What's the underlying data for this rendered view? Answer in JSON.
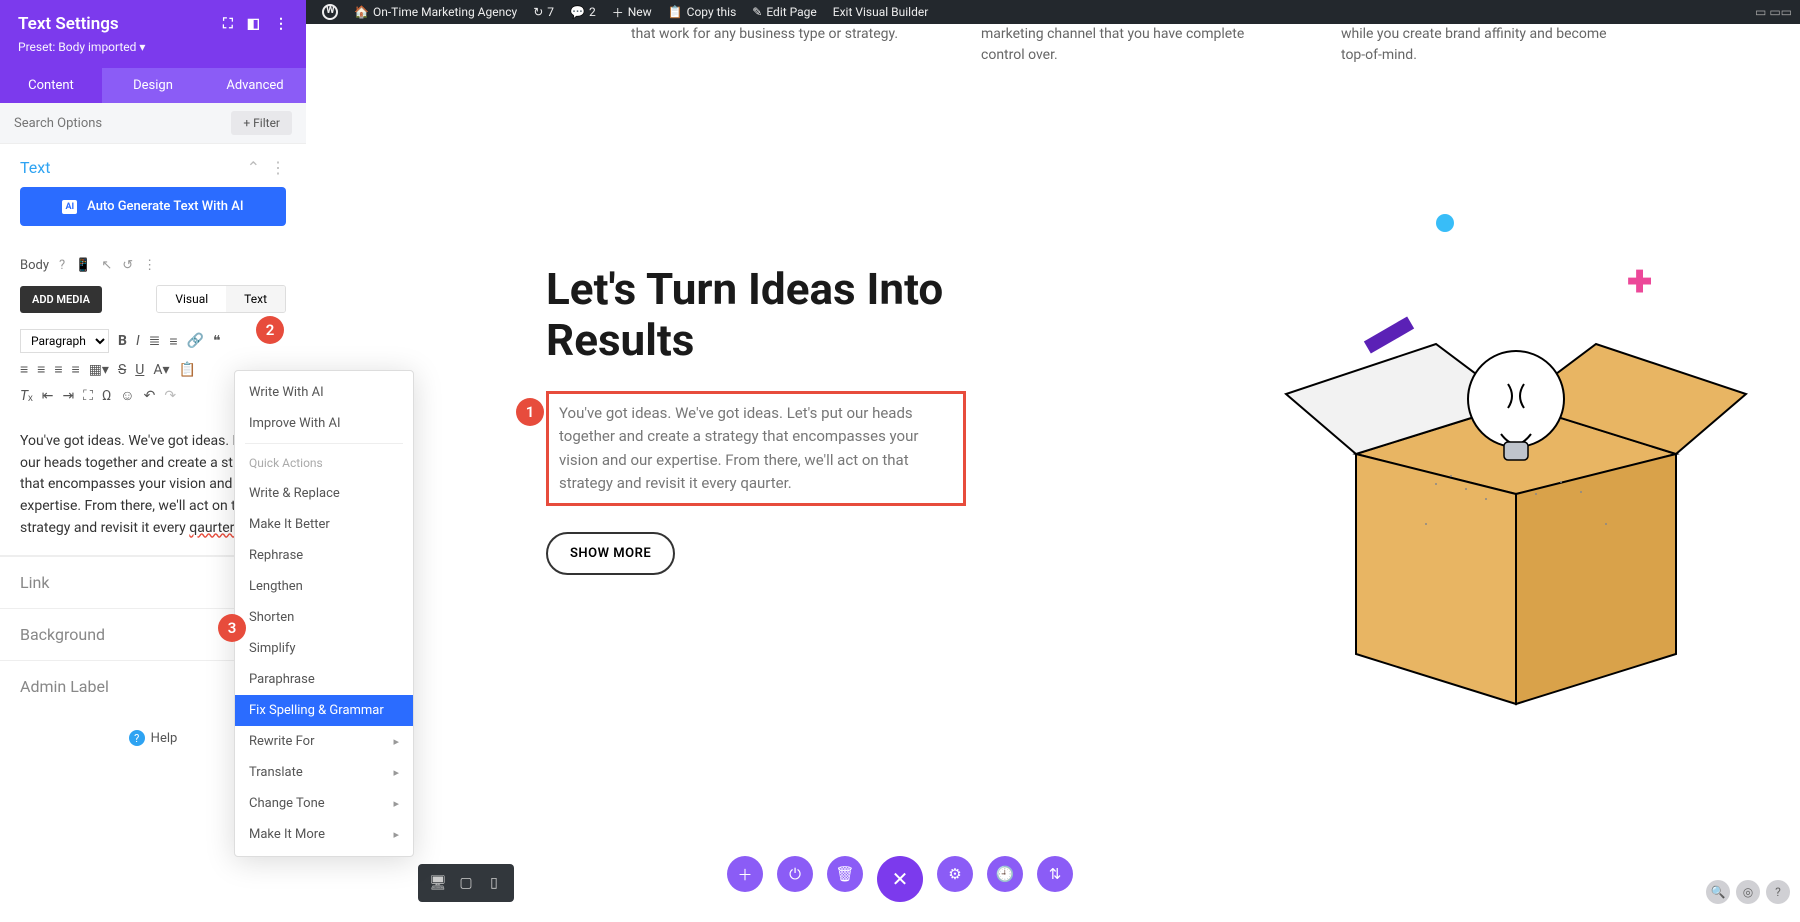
{
  "adminBar": {
    "site": "On-Time Marketing Agency",
    "updates": "7",
    "comments": "2",
    "new": "New",
    "copy": "Copy this",
    "edit": "Edit Page",
    "exit": "Exit Visual Builder"
  },
  "sidebar": {
    "title": "Text Settings",
    "preset": "Preset: Body imported ▾",
    "tabs": {
      "content": "Content",
      "design": "Design",
      "advanced": "Advanced"
    },
    "searchPlaceholder": "Search Options",
    "filter": "Filter",
    "section": "Text",
    "aiButton": "Auto Generate Text With AI",
    "bodyLabel": "Body",
    "addMedia": "ADD MEDIA",
    "editTabs": {
      "visual": "Visual",
      "text": "Text"
    },
    "paragraph": "Paragraph",
    "editorText": "You've got ideas. We've got ideas. Let's put our heads together and create a strategy that encompasses your vision and our expertise. From there, we'll act on that strategy and revisit it every ",
    "editorErr": "qaurter",
    "accordion": {
      "link": "Link",
      "background": "Background",
      "adminLabel": "Admin Label"
    },
    "help": "Help"
  },
  "aiMenu": {
    "write": "Write With AI",
    "improve": "Improve With AI",
    "quick": "Quick Actions",
    "items": [
      "Write & Replace",
      "Make It Better",
      "Rephrase",
      "Lengthen",
      "Shorten",
      "Simplify",
      "Paraphrase",
      "Fix Spelling & Grammar",
      "Rewrite For",
      "Translate",
      "Change Tone",
      "Make It More"
    ],
    "selectedIndex": 7,
    "submenuFrom": 8
  },
  "canvas": {
    "cardTexts": [
      "that work for any business type or strategy.",
      "marketing channel that you have complete control over.",
      "while you create brand affinity and become top-of-mind."
    ],
    "heading": "Let's Turn Ideas Into Results",
    "para": "You've got ideas. We've got ideas. Let's put our heads together and create a strategy that encompasses your vision and our expertise. From there, we'll act on that strategy and revisit it every qaurter.",
    "showMore": "SHOW MORE"
  },
  "callouts": {
    "c1": "1",
    "c2": "2",
    "c3": "3"
  }
}
